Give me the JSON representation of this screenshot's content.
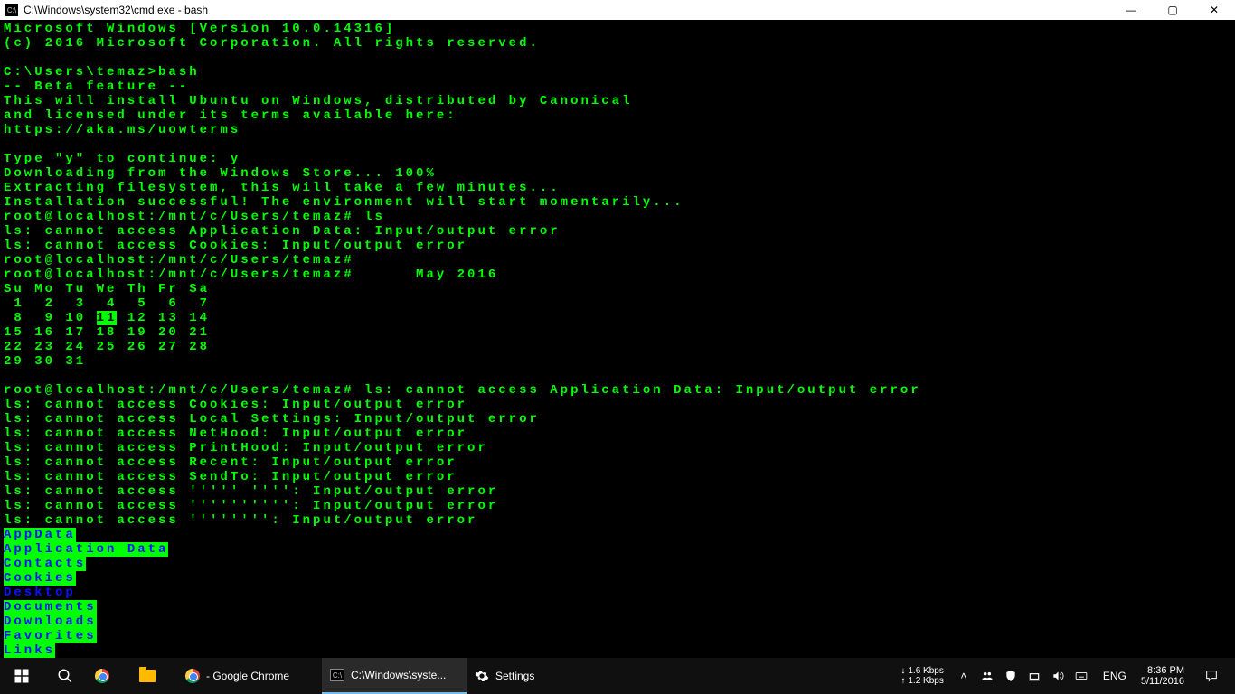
{
  "window": {
    "title": "C:\\Windows\\system32\\cmd.exe - bash",
    "icon_text": "C:\\"
  },
  "terminal": {
    "lines": [
      "Microsoft Windows [Version 10.0.14316]",
      "(c) 2016 Microsoft Corporation. All rights reserved.",
      "",
      "C:\\Users\\temaz>bash",
      "-- Beta feature --",
      "This will install Ubuntu on Windows, distributed by Canonical",
      "and licensed under its terms available here:",
      "https://aka.ms/uowterms",
      "",
      "Type \"y\" to continue: y",
      "Downloading from the Windows Store... 100%",
      "Extracting filesystem, this will take a few minutes...",
      "Installation successful! The environment will start momentarily...",
      "root@localhost:/mnt/c/Users/temaz# ls",
      "ls: cannot access Application Data: Input/output error",
      "ls: cannot access Cookies: Input/output error",
      "root@localhost:/mnt/c/Users/temaz#",
      "root@localhost:/mnt/c/Users/temaz#      May 2016",
      "Su Mo Tu We Th Fr Sa",
      " 1  2  3  4  5  6  7",
      " 8  9 10 ",
      "11",
      " 12 13 14",
      "15 16 17 18 19 20 21",
      "22 23 24 25 26 27 28",
      "29 30 31",
      "",
      "root@localhost:/mnt/c/Users/temaz# ls: cannot access Application Data: Input/output error",
      "ls: cannot access Cookies: Input/output error",
      "ls: cannot access Local Settings: Input/output error",
      "ls: cannot access NetHood: Input/output error",
      "ls: cannot access PrintHood: Input/output error",
      "ls: cannot access Recent: Input/output error",
      "ls: cannot access SendTo: Input/output error",
      "ls: cannot access ''''' '''': Input/output error",
      "ls: cannot access '''''''''': Input/output error",
      "ls: cannot access '''''''': Input/output error"
    ],
    "directories": [
      "AppData",
      "Application Data",
      "Contacts",
      "Cookies",
      "Desktop",
      "Documents",
      "Downloads",
      "Favorites",
      "Links"
    ]
  },
  "taskbar": {
    "chrome_label": "- Google Chrome",
    "cmd_label": "C:\\Windows\\syste...",
    "settings_label": "Settings",
    "net_down": "1.6 Kbps",
    "net_up": "1.2 Kbps",
    "lang": "ENG",
    "time": "8:36 PM",
    "date": "5/11/2016"
  }
}
